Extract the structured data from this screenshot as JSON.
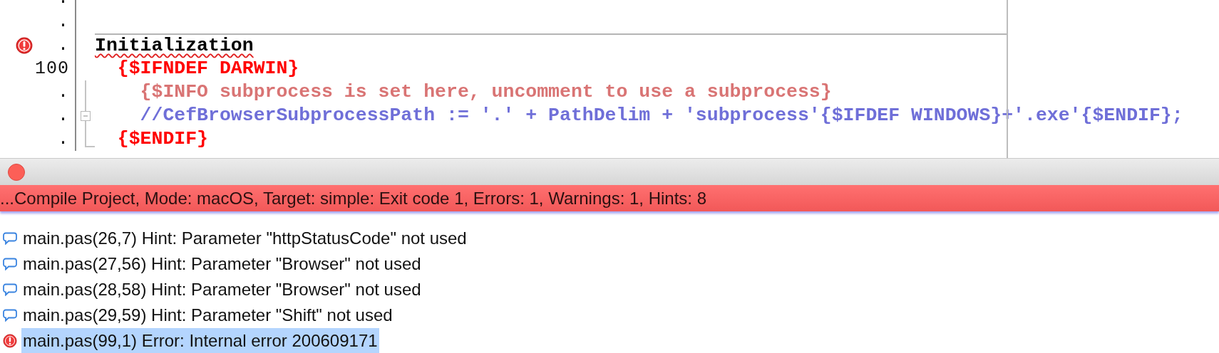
{
  "editor": {
    "lines": [
      {
        "gutter": "."
      },
      {
        "gutter": "."
      },
      {
        "gutter": ".",
        "error": true,
        "kind": "keyword",
        "text": "Initialization",
        "section_break": true,
        "misspelled": true
      },
      {
        "gutter": "100",
        "kind": "directive",
        "text": "  {$IFNDEF DARWIN}"
      },
      {
        "gutter": ".",
        "fold_guide": true,
        "kind": "info",
        "text": "    {$INFO subprocess is set here, uncomment to use a subprocess}"
      },
      {
        "gutter": ".",
        "fold_guide": true,
        "fold_toggle": true,
        "kind": "comment",
        "text": "    //CefBrowserSubprocessPath := '.' + PathDelim + 'subprocess'{$IFDEF WINDOWS}+'.exe'{$ENDIF};"
      },
      {
        "gutter": ".",
        "fold_guide": true,
        "fold_end": true,
        "kind": "directive",
        "text": "  {$ENDIF}"
      }
    ]
  },
  "messages_panel": {
    "error": true,
    "status_text": "...Compile Project, Mode: macOS, Target: simple: Exit code 1, Errors: 1, Warnings: 1, Hints: 8",
    "messages": [
      {
        "kind": "hint",
        "text": "main.pas(26,7) Hint: Parameter \"httpStatusCode\" not used",
        "selected": false
      },
      {
        "kind": "hint",
        "text": "main.pas(27,56) Hint: Parameter \"Browser\" not used",
        "selected": false
      },
      {
        "kind": "hint",
        "text": "main.pas(28,58) Hint: Parameter \"Browser\" not used",
        "selected": false
      },
      {
        "kind": "hint",
        "text": "main.pas(29,59) Hint: Parameter \"Shift\" not used",
        "selected": false
      },
      {
        "kind": "error",
        "text": "main.pas(99,1) Error: Internal error 200609171",
        "selected": true
      }
    ]
  }
}
